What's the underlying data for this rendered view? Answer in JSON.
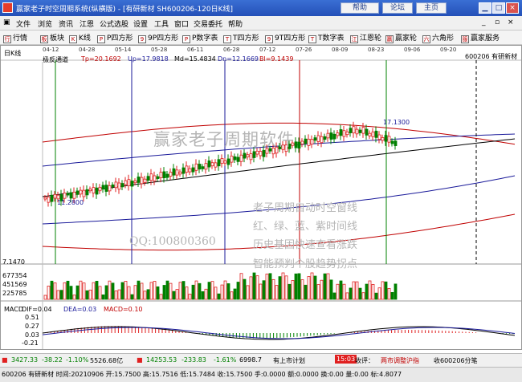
{
  "window": {
    "title": "赢家老子时空周期系统(纵横版) - [有研新材  SH600206-120日K线]",
    "buttons": {
      "register": "帮助",
      "forum": "论坛",
      "home": "主页"
    }
  },
  "menu": [
    "文件",
    "浏览",
    "资讯",
    "江恩",
    "公式选股",
    "设置",
    "工具",
    "窗口",
    "交易委托",
    "帮助"
  ],
  "toolbar": [
    {
      "icon": "行",
      "label": "行情"
    },
    {
      "icon": "板",
      "label": "板块"
    },
    {
      "icon": "K",
      "label": "K线"
    },
    {
      "icon": "P",
      "label": "P四方形"
    },
    {
      "icon": "9",
      "label": "9P四方形"
    },
    {
      "icon": "P",
      "label": "P数字表"
    },
    {
      "icon": "T",
      "label": "T四方形"
    },
    {
      "icon": "9",
      "label": "9T四方形"
    },
    {
      "icon": "T",
      "label": "T数字表"
    },
    {
      "icon": "江",
      "label": "江恩轮"
    },
    {
      "icon": "赢",
      "label": "赢家轮"
    },
    {
      "icon": "六",
      "label": "六角形"
    },
    {
      "icon": "服",
      "label": "赢家服务"
    }
  ],
  "chart": {
    "period_label": "日K线",
    "stock_code_name": "600206 有研新材",
    "indicator_name": "极反通道",
    "tp": "Tp=20.1692",
    "up": "Up=17.9818",
    "md": "Md=15.4834",
    "dn": "Dn=12.1669",
    "bl": "Bl=9.1439",
    "dates": [
      "04-12",
      "04-28",
      "05-14",
      "05-28",
      "06-11",
      "06-28",
      "07-12",
      "07-26",
      "08-09",
      "08-23",
      "09-06",
      "09-20"
    ],
    "price_high_label": "17.1300",
    "price_low_label": "11.2800",
    "axis_low": "7.1470",
    "volume_ticks": [
      "677354",
      "451569",
      "225785"
    ],
    "macd_label": "MACD",
    "dif": "DIF=0.04",
    "dea": "DEA=0.03",
    "macd": "MACD=0.10",
    "macd_ticks": [
      "0.51",
      "0.27",
      "0.03",
      "-0.21"
    ],
    "watermark_main": "赢家老子周期软件",
    "watermark_lines": [
      "老子周期自动时空窗线",
      "红、绿、蓝、紫时间线",
      "历史基因快速查看涨跌",
      "智能预判个股趋势拐点"
    ],
    "watermark_qq": "QQ:100800360",
    "colors": {
      "up": "#e02020",
      "down": "#008000",
      "band_red": "#c00000",
      "band_blue": "#1a1a9a",
      "band_black": "#000000"
    }
  },
  "chart_data": {
    "type": "candlestick",
    "bands": {
      "Tp": 20.1692,
      "Up": 17.9818,
      "Md": 15.4834,
      "Dn": 12.1669,
      "Bl": 9.1439
    },
    "marks": {
      "high": 17.13,
      "low": 11.28
    },
    "y_axis_min": 7.147,
    "volume_axis": [
      677354,
      451569,
      225785
    ],
    "macd_axis": [
      0.51,
      0.27,
      0.03,
      -0.21
    ],
    "macd_values": {
      "DIF": 0.04,
      "DEA": 0.03,
      "MACD": 0.1
    }
  },
  "status1": {
    "sh_index": "3427.33",
    "sh_change": "-38.22",
    "sh_pct": "-1.10%",
    "sh_amount": "5526.68亿",
    "sz_index": "14253.53",
    "sz_change": "-233.83",
    "sz_pct": "-1.61%",
    "sz_amount": "6998.7",
    "ticker_tag": "有上市计划",
    "time": "15:03",
    "market_state": "收评：",
    "news": "两市调整沪指",
    "account": "收600206分笔"
  },
  "status2": {
    "info": "600206 有研新材 时间:20210906 开:15.7500 高:15.7516 低:15.7484 收:15.7500 手:0.0000 额:0.0000 换:0.00 量:0.00 标:4.8077"
  }
}
